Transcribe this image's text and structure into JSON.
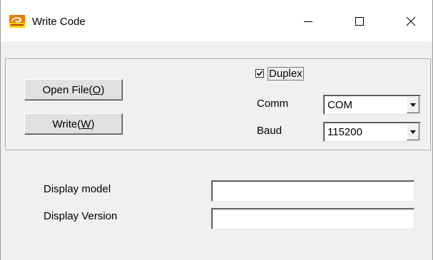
{
  "window": {
    "title": "Write Code",
    "app_icon": "app-logo-icon",
    "controls": {
      "minimize": "minimize-icon",
      "maximize": "maximize-icon",
      "close": "close-icon"
    }
  },
  "toolbar": {
    "open_file": {
      "prefix": "Open File(",
      "accel": "O",
      "suffix": ")"
    },
    "write": {
      "prefix": "Write(",
      "accel": "W",
      "suffix": ")"
    }
  },
  "duplex": {
    "label": "Duplex",
    "checked": true
  },
  "comm": {
    "label": "Comm",
    "selected": "COM"
  },
  "baud": {
    "label": "Baud",
    "selected": "115200"
  },
  "info": {
    "model_label": "Display model",
    "model_value": "",
    "version_label": "Display Version",
    "version_value": ""
  },
  "colors": {
    "window_bg": "#f0f0f0",
    "titlebar_bg": "#ffffff",
    "icon_orange": "#f07800",
    "icon_yellow": "#ffd200"
  }
}
